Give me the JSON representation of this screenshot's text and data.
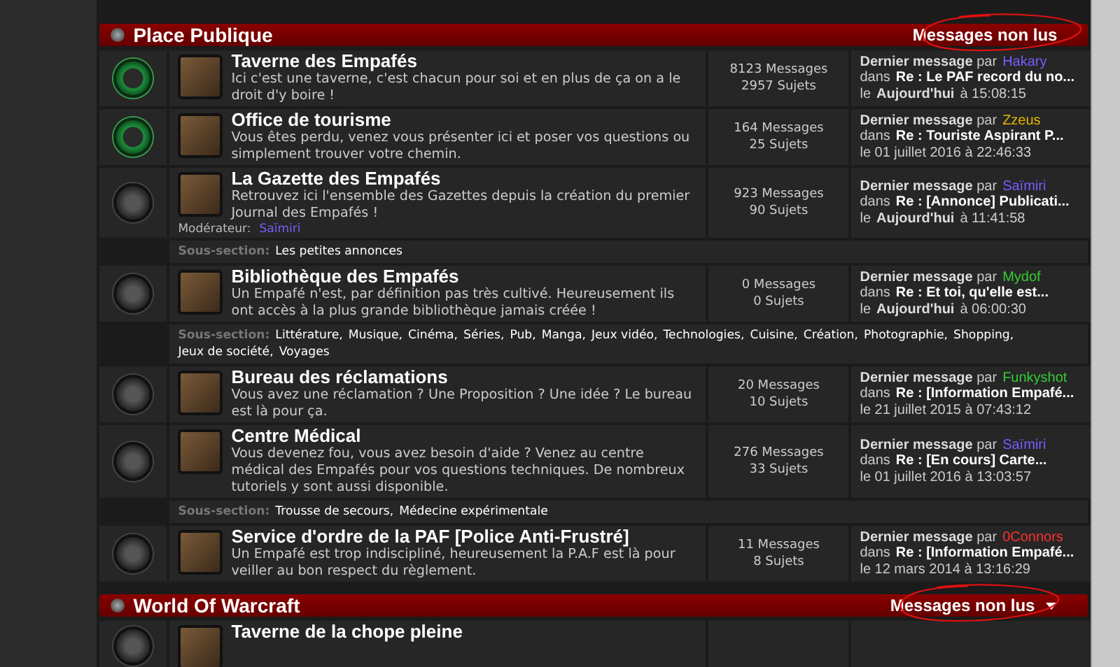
{
  "categories": [
    {
      "title": "Place Publique",
      "unread_label": "Messages non lus",
      "dropdown": false,
      "circled": true,
      "forums": [
        {
          "title": "Taverne des Empafés",
          "description": "Ici c'est une taverne, c'est chacun pour soi et en plus de ça on a le droit d'y boire !",
          "unread": true,
          "messages": "8123 Messages",
          "topics": "2957 Sujets",
          "last": {
            "label": "**Dernier message** par",
            "user": "Hakary",
            "color": "#7b5cff",
            "in": "dans",
            "topic": "Re : Le PAF record du no...",
            "date": "le **Aujourd'hui** à 15:08:15"
          }
        },
        {
          "title": "Office de tourisme",
          "description": "Vous êtes perdu, venez vous présenter ici et poser vos questions ou simplement trouver votre chemin.",
          "unread": true,
          "messages": "164 Messages",
          "topics": "25 Sujets",
          "last": {
            "label": "**Dernier message** par",
            "user": "Zzeus",
            "color": "#e6b800",
            "in": "dans",
            "topic": "Re : Touriste Aspirant P...",
            "date": "le 01 juillet 2016 à 22:46:33"
          }
        },
        {
          "title": "La Gazette des Empafés",
          "description": "Retrouvez ici l'ensemble des Gazettes depuis la création du premier Journal des Empafés !",
          "unread": false,
          "moderator_label": "Modérateur:",
          "moderator": {
            "name": "Saïmiri",
            "color": "#7b5cff"
          },
          "messages": "923 Messages",
          "topics": "90 Sujets",
          "last": {
            "label": "**Dernier message** par",
            "user": "Saïmiri",
            "color": "#7b5cff",
            "in": "dans",
            "topic": "Re : [Annonce] Publicati...",
            "date": "le **Aujourd'hui** à 11:41:58"
          },
          "subsection_label": "Sous-section:",
          "subsections": [
            "Les petites annonces"
          ]
        },
        {
          "title": "Bibliothèque des Empafés",
          "description": "Un Empafé n'est, par définition pas très cultivé. Heureusement ils ont accès à la plus grande bibliothèque jamais créée !",
          "unread": false,
          "messages": "0 Messages",
          "topics": "0 Sujets",
          "last": {
            "label": "**Dernier message** par",
            "user": "Mydof",
            "color": "#33cc33",
            "in": "dans",
            "topic": "Re : Et toi, qu'elle est...",
            "date": "le **Aujourd'hui** à 06:00:30"
          },
          "subsection_label": "Sous-section:",
          "subsections": [
            "Littérature,",
            "Musique,",
            "Cinéma,",
            "Séries,",
            "Pub,",
            "Manga,",
            "Jeux vidéo,",
            "Technologies,",
            "Cuisine,",
            "Création,",
            "Photographie,",
            "Shopping,",
            "Jeux de société,",
            "Voyages"
          ]
        },
        {
          "title": "Bureau des réclamations",
          "description": "Vous avez une réclamation ? Une Proposition ? Une idée ? Le bureau est là pour ça.",
          "unread": false,
          "messages": "20 Messages",
          "topics": "10 Sujets",
          "last": {
            "label": "**Dernier message** par",
            "user": "Funkyshot",
            "color": "#33cc33",
            "in": "dans",
            "topic": "Re : [Information Empafé...",
            "date": "le 21 juillet 2015 à 07:43:12"
          }
        },
        {
          "title": "Centre Médical",
          "description": "Vous devenez fou, vous avez besoin d'aide ? Venez au centre médical des Empafés pour vos questions techniques. De nombreux tutoriels y sont aussi disponible.",
          "unread": false,
          "messages": "276 Messages",
          "topics": "33 Sujets",
          "last": {
            "label": "**Dernier message** par",
            "user": "Saïmiri",
            "color": "#7b5cff",
            "in": "dans",
            "topic": "Re : [En cours] Carte...",
            "date": "le 01 juillet 2016 à 13:03:57"
          },
          "subsection_label": "Sous-section:",
          "subsections": [
            "Trousse de secours,",
            "Médecine expérimentale"
          ]
        },
        {
          "title": "Service d'ordre de la PAF [Police Anti-Frustré]",
          "description": "Un Empafé est trop indiscipliné, heureusement la P.A.F est là pour veiller au bon respect du règlement.",
          "unread": false,
          "messages": "11 Messages",
          "topics": "8 Sujets",
          "last": {
            "label": "**Dernier message** par",
            "user": "0Connors",
            "color": "#ff3030",
            "in": "dans",
            "topic": "Re : [Information Empafé...",
            "date": "le 12 mars 2014 à 13:16:29"
          }
        }
      ]
    },
    {
      "title": "World Of Warcraft",
      "unread_label": "Messages non lus",
      "dropdown": true,
      "circled": true,
      "forums": [
        {
          "title": "Taverne de la chope pleine",
          "unread": false
        }
      ]
    }
  ]
}
